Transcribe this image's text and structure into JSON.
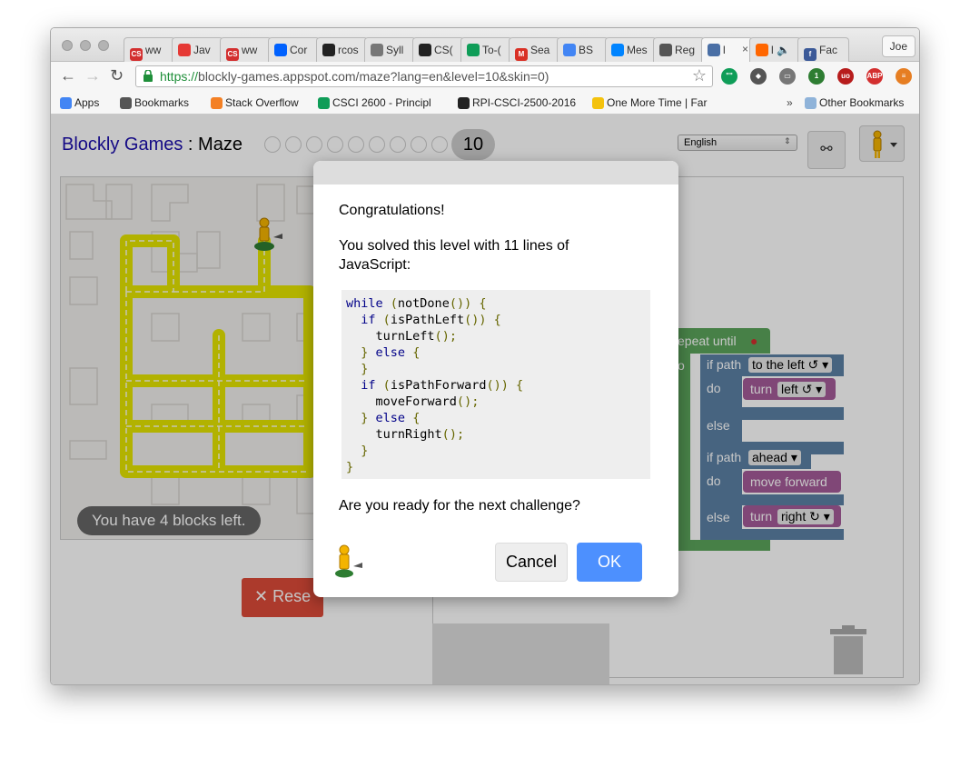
{
  "browser": {
    "tabs": [
      {
        "label": "ww",
        "color": "#d32f2f",
        "fav": "CS"
      },
      {
        "label": "Jav",
        "color": "#e53935",
        "fav": ""
      },
      {
        "label": "ww",
        "color": "#d32f2f",
        "fav": "CS"
      },
      {
        "label": "Cor",
        "color": "#0061fe",
        "fav": ""
      },
      {
        "label": "rcos",
        "color": "#222222",
        "fav": ""
      },
      {
        "label": "Syll",
        "color": "#777777",
        "fav": ""
      },
      {
        "label": "CS(",
        "color": "#222222",
        "fav": ""
      },
      {
        "label": "To-(",
        "color": "#0f9d58",
        "fav": ""
      },
      {
        "label": "Sea",
        "color": "#d93025",
        "fav": "M"
      },
      {
        "label": "BS",
        "color": "#4285f4",
        "fav": ""
      },
      {
        "label": "Mes",
        "color": "#0084ff",
        "fav": ""
      },
      {
        "label": "Reg",
        "color": "#555555",
        "fav": ""
      },
      {
        "label": "l",
        "color": "#4a6fa5",
        "fav": ""
      },
      {
        "label": "l 🔈",
        "color": "#ff6600",
        "fav": ""
      },
      {
        "label": "Fac",
        "color": "#3b5998",
        "fav": "f"
      }
    ],
    "user_button": "Joe",
    "url_scheme": "https://",
    "url_rest": "blockly-games.appspot.com/maze?lang=en&level=10&skin=0)",
    "bookmarks": [
      {
        "label": "Apps",
        "color": "#4285f4"
      },
      {
        "label": "Bookmarks",
        "color": "#555555"
      },
      {
        "label": "Stack Overflow",
        "color": "#f48024"
      },
      {
        "label": "CSCI 2600 - Principl",
        "color": "#0f9d58"
      },
      {
        "label": "RPI-CSCI-2500-2016",
        "color": "#222222"
      },
      {
        "label": "One More Time | Far",
        "color": "#f4c20d"
      }
    ],
    "bookmarks_more": "»",
    "other_bookmarks": "Other Bookmarks",
    "extensions": [
      {
        "name": "hangouts-icon",
        "color": "#0f9d58",
        "label": "\"\""
      },
      {
        "name": "pushbullet-icon",
        "color": "#555555",
        "label": "◆"
      },
      {
        "name": "cast-icon",
        "color": "#777777",
        "label": "▭"
      },
      {
        "name": "ext-green-icon",
        "color": "#2e7d32",
        "label": "1"
      },
      {
        "name": "ublock-icon",
        "color": "#b71c1c",
        "label": "uo"
      },
      {
        "name": "adblock-icon",
        "color": "#d32f2f",
        "label": "ABP"
      },
      {
        "name": "menu-icon",
        "color": "#e67e22",
        "label": "≡"
      }
    ]
  },
  "page": {
    "brand": "Blockly Games",
    "separator": " : ",
    "title": "Maze",
    "level": "10",
    "language": "English",
    "blocks_left": "You have 4 blocks left.",
    "reset_label": "Rese"
  },
  "blocks": {
    "repeat_until": "epeat until",
    "do_label": "o",
    "if_path": "if path",
    "to_the_left": "to the left ↺ ▾",
    "do": "do",
    "turn": "turn",
    "left": "left ↺ ▾",
    "else": "else",
    "ahead": "ahead ▾",
    "move_forward": "move forward",
    "right": "right ↻ ▾"
  },
  "dialog": {
    "heading": "Congratulations!",
    "message": "You solved this level with 11 lines of JavaScript:",
    "code": [
      "while (notDone()) {",
      "  if (isPathLeft()) {",
      "    turnLeft();",
      "  } else {",
      "  }",
      "  if (isPathForward()) {",
      "    moveForward();",
      "  } else {",
      "    turnRight();",
      "  }",
      "}"
    ],
    "question": "Are you ready for the next challenge?",
    "cancel": "Cancel",
    "ok": "OK"
  },
  "colors": {
    "logic_blue": "#5b80a5",
    "loop_green": "#5ba55b",
    "motion_purple": "#a55b99",
    "path_yellow": "#e5e500",
    "ok_blue": "#4d90fe",
    "reset_red": "#dd4b39"
  }
}
